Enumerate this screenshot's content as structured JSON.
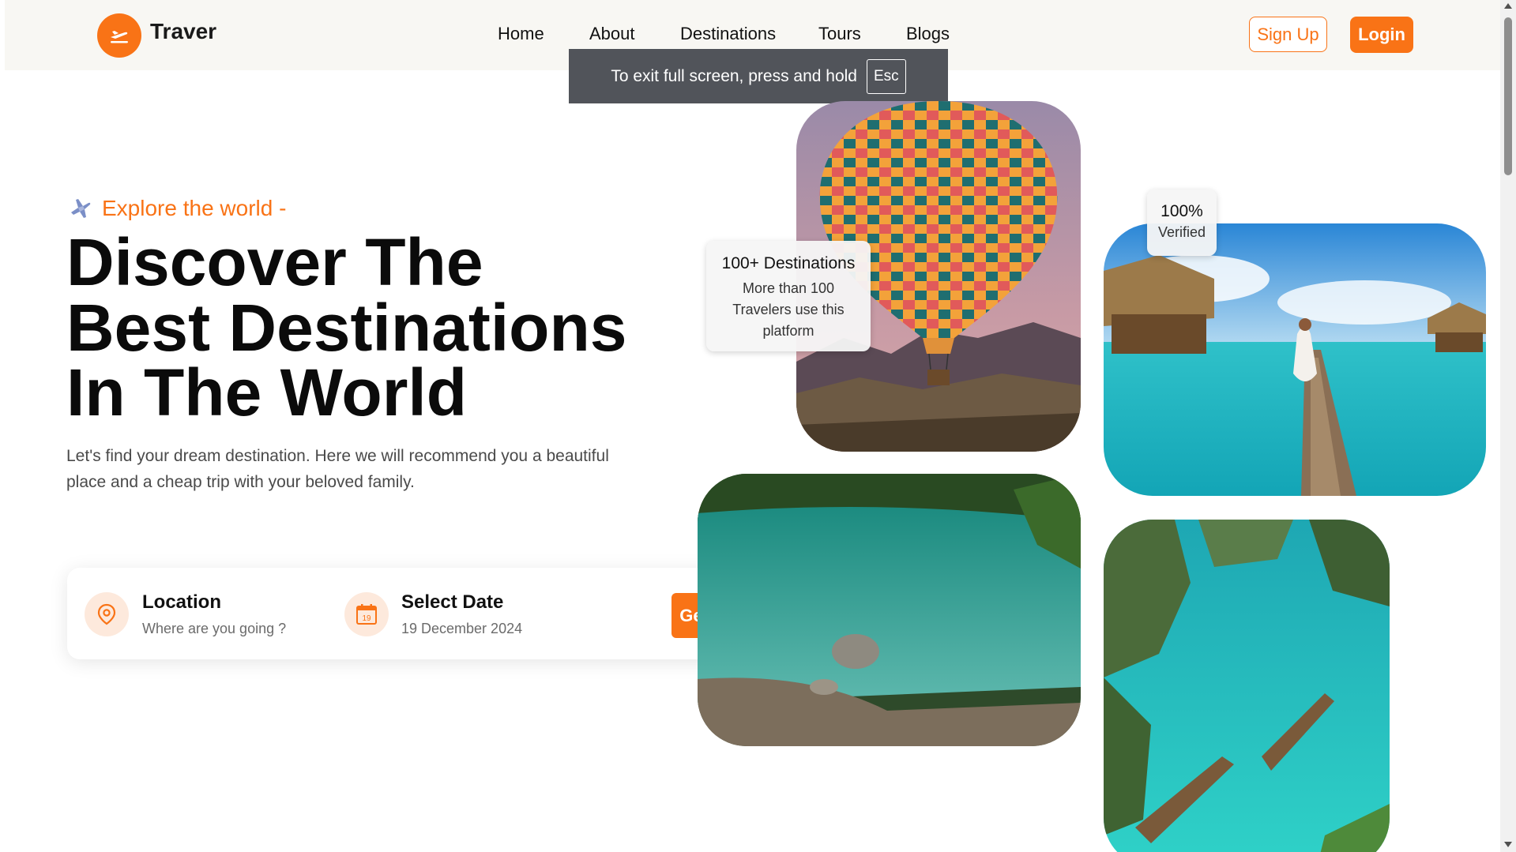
{
  "brand": {
    "name": "Traver",
    "accent": "#f97316",
    "logo_icon": "plane-takeoff-icon"
  },
  "nav": {
    "items": [
      "Home",
      "About",
      "Destinations",
      "Tours",
      "Blogs"
    ]
  },
  "auth": {
    "signup": "Sign Up",
    "login": "Login"
  },
  "toast": {
    "text": "To exit full screen, press and hold",
    "key": "Esc"
  },
  "hero": {
    "tagline": "Explore the world -",
    "tagline_icon": "airplane-icon",
    "title_lines": [
      "Discover The",
      "Best Destinations",
      "In The World"
    ],
    "description": "Let's find your dream destination. Here we will recommend you a beautiful place and a cheap trip with your beloved family."
  },
  "search": {
    "location": {
      "label": "Location",
      "placeholder": "Where are you going ?",
      "icon": "map-pin-icon"
    },
    "date": {
      "label": "Select Date",
      "value": "19 December 2024",
      "icon": "calendar-icon",
      "icon_day": "19"
    },
    "cta": "Get Started"
  },
  "stats": {
    "destinations": {
      "title": "100+ Destinations",
      "desc": "More than 100 Travelers use this platform"
    },
    "verified": {
      "value": "100%",
      "label": "Verified"
    }
  }
}
